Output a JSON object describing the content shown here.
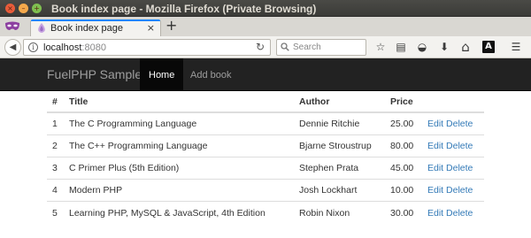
{
  "window": {
    "title": "Book index page - Mozilla Firefox (Private Browsing)",
    "close_glyph": "×",
    "min_glyph": "–",
    "max_glyph": "+"
  },
  "tab": {
    "label": "Book index page",
    "close_glyph": "×",
    "new_tab_glyph": "+"
  },
  "navbar": {
    "back_glyph": "◀",
    "url_host": "localhost",
    "url_port": ":8080",
    "search_placeholder": "Search",
    "reload_glyph": "↻"
  },
  "toolbar_icons": [
    {
      "name": "bookmark-star-icon",
      "glyph": "☆"
    },
    {
      "name": "reader-view-icon",
      "glyph": "▤"
    },
    {
      "name": "pocket-icon",
      "glyph": "◒"
    },
    {
      "name": "downloads-icon",
      "glyph": "⬇"
    },
    {
      "name": "home-icon",
      "glyph": "⌂"
    },
    {
      "name": "extension-a-icon",
      "glyph": "A"
    },
    {
      "name": "menu-icon",
      "glyph": "☰"
    }
  ],
  "app": {
    "brand": "FuelPHP Sample",
    "nav": [
      {
        "label": "Home",
        "active": true
      },
      {
        "label": "Add book",
        "active": false
      }
    ]
  },
  "table": {
    "headers": [
      "#",
      "Title",
      "Author",
      "Price"
    ],
    "rows": [
      {
        "id": "1",
        "title": "The C Programming Language",
        "author": "Dennie Ritchie",
        "price": "25.00"
      },
      {
        "id": "2",
        "title": "The C++ Programming Language",
        "author": "Bjarne Stroustrup",
        "price": "80.00"
      },
      {
        "id": "3",
        "title": "C Primer Plus (5th Edition)",
        "author": "Stephen Prata",
        "price": "45.00"
      },
      {
        "id": "4",
        "title": "Modern PHP",
        "author": "Josh Lockhart",
        "price": "10.00"
      },
      {
        "id": "5",
        "title": "Learning PHP, MySQL & JavaScript, 4th Edition",
        "author": "Robin Nixon",
        "price": "30.00"
      }
    ],
    "edit_label": "Edit",
    "delete_label": "Delete"
  },
  "colors": {
    "link": "#337ab7",
    "app_nav_bg": "#222222",
    "tab_accent": "#0a84ff"
  }
}
